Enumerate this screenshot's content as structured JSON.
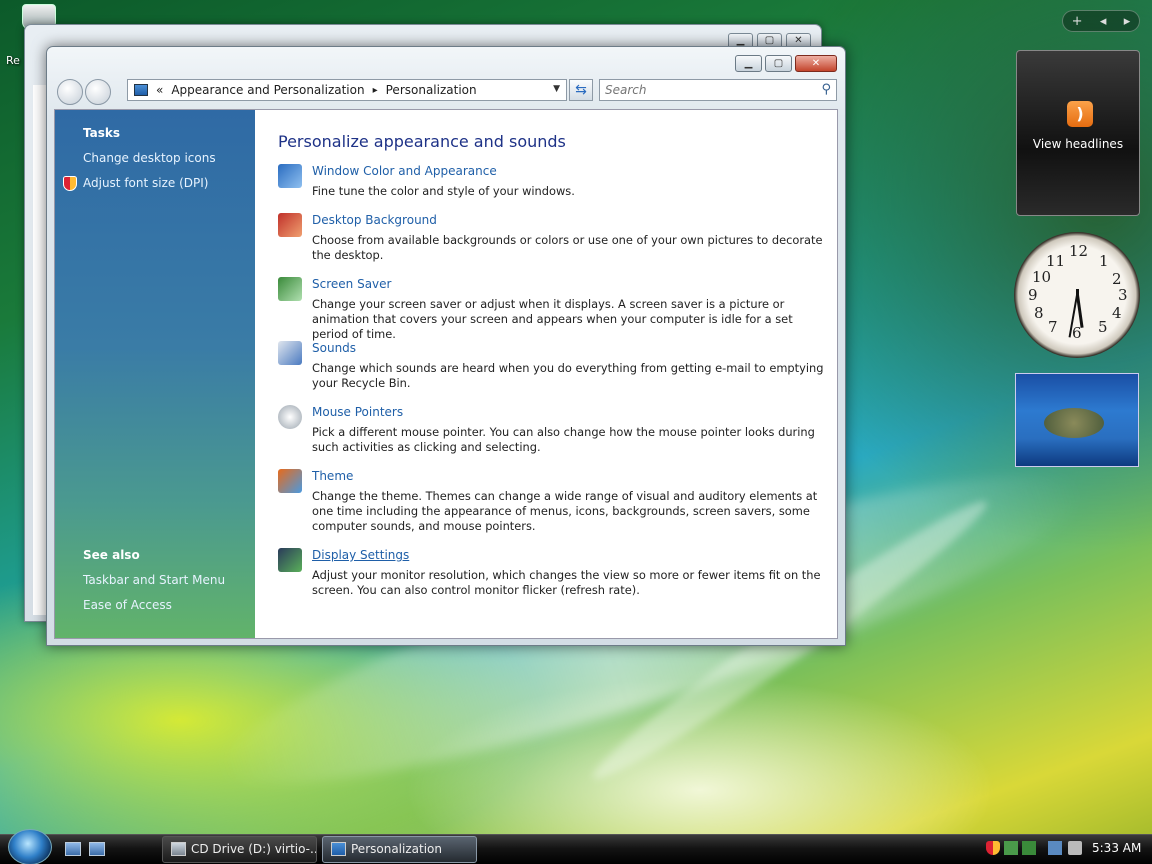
{
  "desktop": {
    "recycle_label": "Re"
  },
  "window": {
    "address": {
      "chevron": "«",
      "crumbs": [
        "Appearance and Personalization",
        "Personalization"
      ],
      "separator": "▸"
    },
    "search_placeholder": "Search",
    "left_pane": {
      "tasks_heading": "Tasks",
      "tasks": [
        "Change desktop icons",
        "Adjust font size (DPI)"
      ],
      "see_also_heading": "See also",
      "see_also": [
        "Taskbar and Start Menu",
        "Ease of Access"
      ]
    },
    "page_title": "Personalize appearance and sounds",
    "items": [
      {
        "icon": "window-color-icon",
        "title": "Window Color and Appearance",
        "desc": "Fine tune the color and style of your windows."
      },
      {
        "icon": "desktop-background-icon",
        "title": "Desktop Background",
        "desc": "Choose from available backgrounds or colors or use one of your own pictures to decorate the desktop."
      },
      {
        "icon": "screen-saver-icon",
        "title": "Screen Saver",
        "desc": "Change your screen saver or adjust when it displays. A screen saver is a picture or animation that covers your screen and appears when your computer is idle for a set period of time."
      },
      {
        "icon": "sounds-icon",
        "title": "Sounds",
        "desc": "Change which sounds are heard when you do everything from getting e-mail to emptying your Recycle Bin."
      },
      {
        "icon": "mouse-pointer-icon",
        "title": "Mouse Pointers",
        "desc": "Pick a different mouse pointer. You can also change how the mouse pointer looks during such activities as clicking and selecting."
      },
      {
        "icon": "theme-icon",
        "title": "Theme",
        "desc": "Change the theme. Themes can change a wide range of visual and auditory elements at one time including the appearance of menus, icons, backgrounds, screen savers, some computer sounds, and mouse pointers."
      },
      {
        "icon": "display-settings-icon",
        "title": "Display Settings",
        "desc": "Adjust your monitor resolution, which changes the view so more or fewer items fit on the screen. You can also control monitor flicker (refresh rate)."
      }
    ]
  },
  "gadgets": {
    "bar": [
      "+",
      "◂",
      "▸"
    ],
    "feed_label": "View headlines",
    "clock_numbers": [
      "12",
      "1",
      "2",
      "3",
      "4",
      "5",
      "6",
      "7",
      "8",
      "9",
      "10",
      "11"
    ]
  },
  "taskbar": {
    "buttons": [
      "CD Drive (D:) virtio-...",
      "Personalization"
    ],
    "time": "5:33 AM"
  },
  "colors": {
    "link": "#1f5fa8",
    "title": "#1e3287"
  }
}
